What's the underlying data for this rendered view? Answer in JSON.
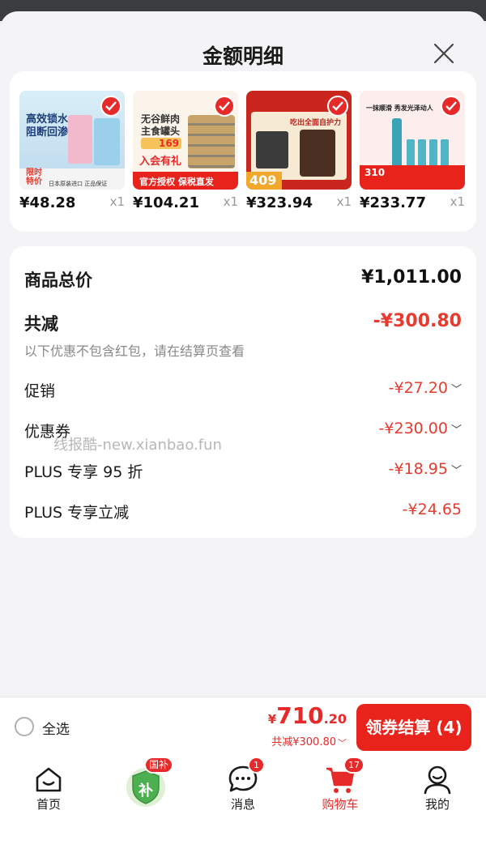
{
  "header": {
    "title": "金额明细"
  },
  "products": [
    {
      "price": "¥48.28",
      "qty": "x1",
      "img_lines": [
        "高效锁水",
        "阻断回渗"
      ],
      "img_tag": "限时\n特价",
      "img_bottom": "日本原装进口 正品保证"
    },
    {
      "price": "¥104.21",
      "qty": "x1",
      "img_lines": [
        "无谷鲜肉",
        "主食罐头"
      ],
      "img_promo": "169",
      "img_member": "入会有礼",
      "img_bottom": "官方授权 保税直发"
    },
    {
      "price": "¥323.94",
      "qty": "x1",
      "img_lines": [
        "吃出全面自护力"
      ],
      "img_promo": "409"
    },
    {
      "price": "¥233.77",
      "qty": "x1",
      "img_lines": [
        "一抹顺滑 秀发光泽动人"
      ],
      "img_promo": "310"
    }
  ],
  "summary": {
    "subtotal_label": "商品总价",
    "subtotal_value": "¥1,011.00",
    "total_discount_label": "共减",
    "total_discount_value": "-¥300.80",
    "hint": "以下优惠不包含红包，请在结算页查看",
    "rows": [
      {
        "label": "促销",
        "value": "-¥27.20"
      },
      {
        "label": "优惠券",
        "value": "-¥230.00"
      },
      {
        "label": "PLUS 专享 95 折",
        "value": "-¥18.95"
      },
      {
        "label": "PLUS 专享立减",
        "value": "-¥24.65"
      }
    ]
  },
  "watermark": "线报酷-new.xianbao.fun",
  "checkout": {
    "select_all": "全选",
    "currency": "¥",
    "total_int": "710",
    "total_dec": ".20",
    "discount_text": "共减¥300.80",
    "button_label": "领券结算 (4)"
  },
  "tabbar": {
    "home": "首页",
    "subsidy_badge": "国补",
    "subsidy_icon_text": "补",
    "messages": "消息",
    "messages_badge": "1",
    "cart": "购物车",
    "cart_badge": "17",
    "me": "我的"
  },
  "colors": {
    "accent": "#e62a2a",
    "discount": "#e63b2e",
    "sheet": "#f4f4f6"
  }
}
